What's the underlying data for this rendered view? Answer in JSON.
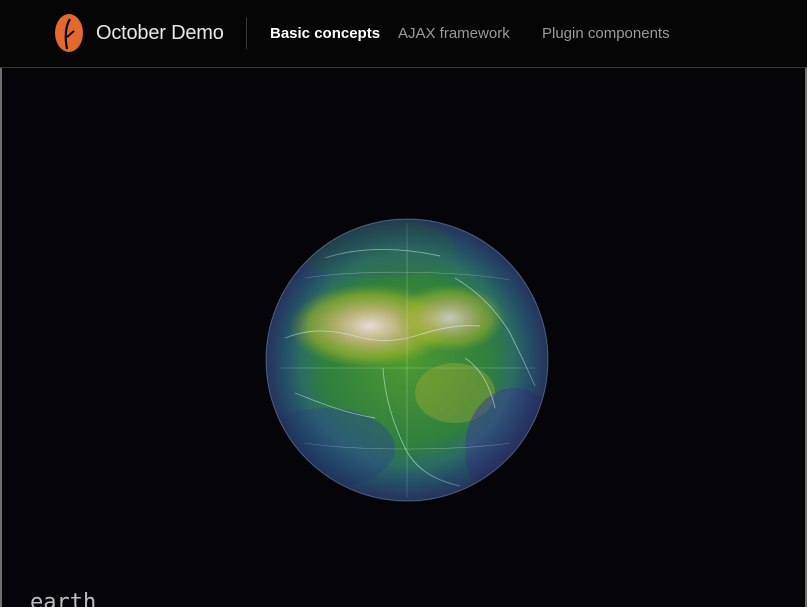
{
  "brand": {
    "name": "October Demo",
    "logo_icon": "october-leaf-logo-icon",
    "logo_color": "#e36a2a"
  },
  "nav": {
    "items": [
      {
        "label": "Basic concepts",
        "active": true
      },
      {
        "label": "AJAX framework",
        "active": false
      },
      {
        "label": "Plugin components",
        "active": false
      }
    ]
  },
  "main": {
    "widget_label": "earth",
    "visual": "earth-wind-globe"
  },
  "colors": {
    "background": "#000000",
    "nav_active": "#ffffff",
    "nav_inactive": "#9a9a9a"
  }
}
